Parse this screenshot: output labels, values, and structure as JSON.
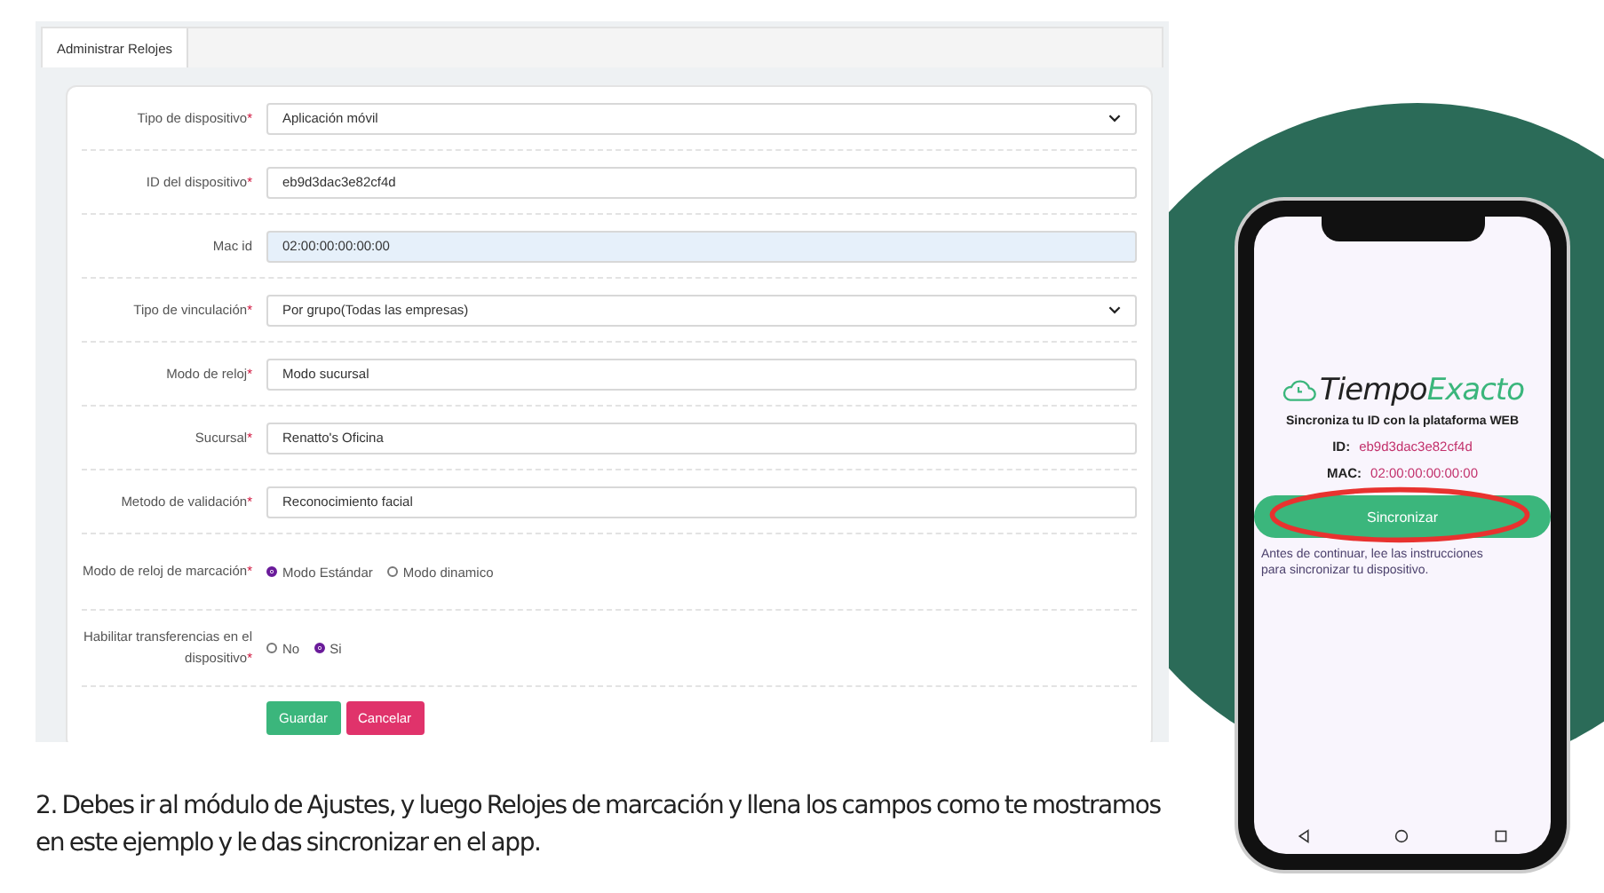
{
  "tabs": [
    {
      "label": "Administrar Relojes",
      "selected": true
    }
  ],
  "fields": [
    {
      "label": "Tipo de dispositivo",
      "required_mark": "*",
      "kind": "select",
      "value": "Aplicación móvil"
    },
    {
      "label": "ID del dispositivo",
      "required_mark": "*",
      "kind": "input",
      "value": "eb9d3dac3e82cf4d"
    },
    {
      "label": "Mac id",
      "kind": "autofill",
      "value": "02:00:00:00:00:00"
    },
    {
      "label": "Tipo de vinculación",
      "required_mark": "*",
      "kind": "select",
      "value": "Por grupo(Todas las empresas)"
    },
    {
      "label": "Modo de reloj",
      "required_mark": "*",
      "kind": "input",
      "value": "Modo sucursal"
    },
    {
      "label": "Sucursal",
      "required_mark": "*",
      "kind": "input",
      "value": "Renatto's Oficina"
    },
    {
      "label": "Metodo de validación",
      "required_mark": "*",
      "kind": "input",
      "value": "Reconocimiento facial"
    },
    {
      "label": "Modo de reloj de marcación",
      "required_mark": "*",
      "kind": "radio",
      "options": [
        {
          "label": "Modo Estándar",
          "selected": true
        },
        {
          "label": "Modo dinamico",
          "selected": false
        }
      ]
    },
    {
      "label": "Habilitar transferencias en el dispositivo",
      "required_mark": "*",
      "kind": "radio",
      "options": [
        {
          "label": "No",
          "selected": false
        },
        {
          "label": "Si",
          "selected": true
        }
      ]
    }
  ],
  "buttons": [
    {
      "label": "Guardar",
      "kind": "primary"
    },
    {
      "label": "Cancelar",
      "kind": "danger"
    }
  ],
  "caption": "2. Debes ir al módulo de Ajustes, y luego Relojes de marcación y llena los campos como te mostramos en este ejemplo y le das sincronizar en el app.",
  "phone": {
    "logo_first": "Tiempo",
    "logo_second": "Exacto",
    "subtitle": "Sincroniza tu ID con la plataforma WEB",
    "id_label": "ID:",
    "id_value": "eb9d3dac3e82cf4d",
    "mac_label": "MAC:",
    "mac_value": "02:00:00:00:00:00",
    "button": "Sincronizar",
    "note": "Antes de continuar, lee las instrucciones para sincronizar tu dispositivo."
  }
}
